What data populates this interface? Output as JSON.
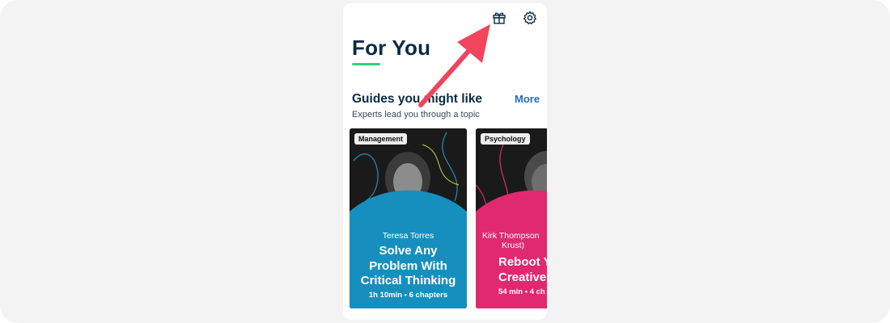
{
  "header": {
    "gift_icon": "gift-icon",
    "settings_icon": "gear-icon"
  },
  "page": {
    "title": "For You"
  },
  "section": {
    "title": "Guides you might like",
    "subtitle": "Experts lead you through a topic",
    "more_label": "More"
  },
  "cards": [
    {
      "tag": "Management",
      "author": "Teresa Torres",
      "title_lines": [
        "Solve Any",
        "Problem With",
        "Critical Thinking"
      ],
      "meta": "1h 10min • 6 chapters",
      "panel_color": "#178fbe"
    },
    {
      "tag": "Psychology",
      "author_lines": [
        "Kirk Thompson",
        "Krust)"
      ],
      "title_lines": [
        "Reboot Y",
        "Creative M"
      ],
      "meta": "54 min • 4 ch",
      "panel_color": "#e1296f"
    }
  ],
  "annotation": {
    "arrow_color": "#f0455c"
  }
}
